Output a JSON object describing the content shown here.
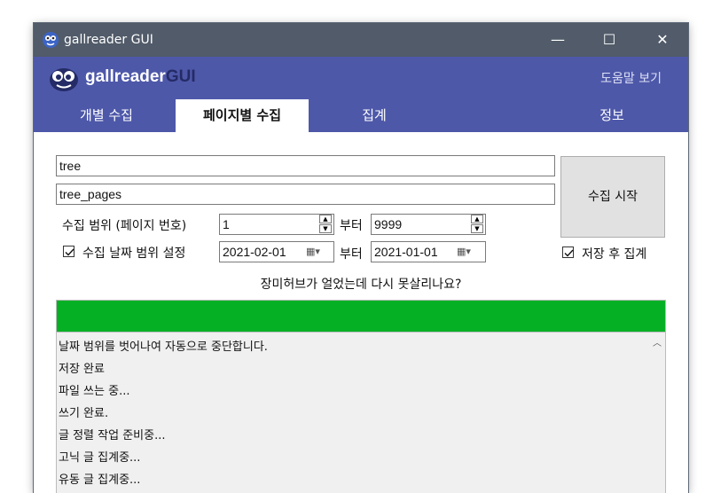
{
  "window": {
    "title": "gallreader GUI"
  },
  "titlebar_buttons": {
    "minimize": "—",
    "maximize": "☐",
    "close": "✕"
  },
  "header": {
    "logo_text_1": "gallreader",
    "logo_text_2": "GUI",
    "help": "도움말 보기",
    "tabs": [
      {
        "label": "개별 수집"
      },
      {
        "label": "페이지별 수집"
      },
      {
        "label": "집계"
      },
      {
        "label": "정보"
      }
    ]
  },
  "form": {
    "gallery_id": "tree",
    "output_name": "tree_pages",
    "page_range_label": "수집 범위 (페이지 번호)",
    "page_from": "1",
    "from_label": "부터",
    "page_to": "9999",
    "date_range_label": "수집 날짜 범위 설정",
    "date_from": "2021-02-01",
    "date_to": "2021-01-01",
    "start_button": "수집 시작",
    "aggregate_after_save": "저장 후 집계"
  },
  "status_text": "장미허브가 얼었는데 다시 못살리나요?",
  "progress": {
    "value": 1.0,
    "color": "#06b025"
  },
  "log_lines": [
    "날짜 범위를 벗어나여 자동으로 중단합니다.",
    "저장 완료",
    "파일 쓰는 중...",
    "쓰기 완료.",
    "글 정렬 작업 준비중...",
    "고닉 글 집계중...",
    "유동 글 집계중..."
  ],
  "colors": {
    "titlebar": "#515b69",
    "header": "#4e58a9",
    "logo_dark": "#242b66"
  },
  "icons": {
    "app": "gallreader-logo-icon",
    "calendar": "calendar-dropdown-icon",
    "check": "check-icon",
    "scroll_up": "chevron-up-icon"
  }
}
